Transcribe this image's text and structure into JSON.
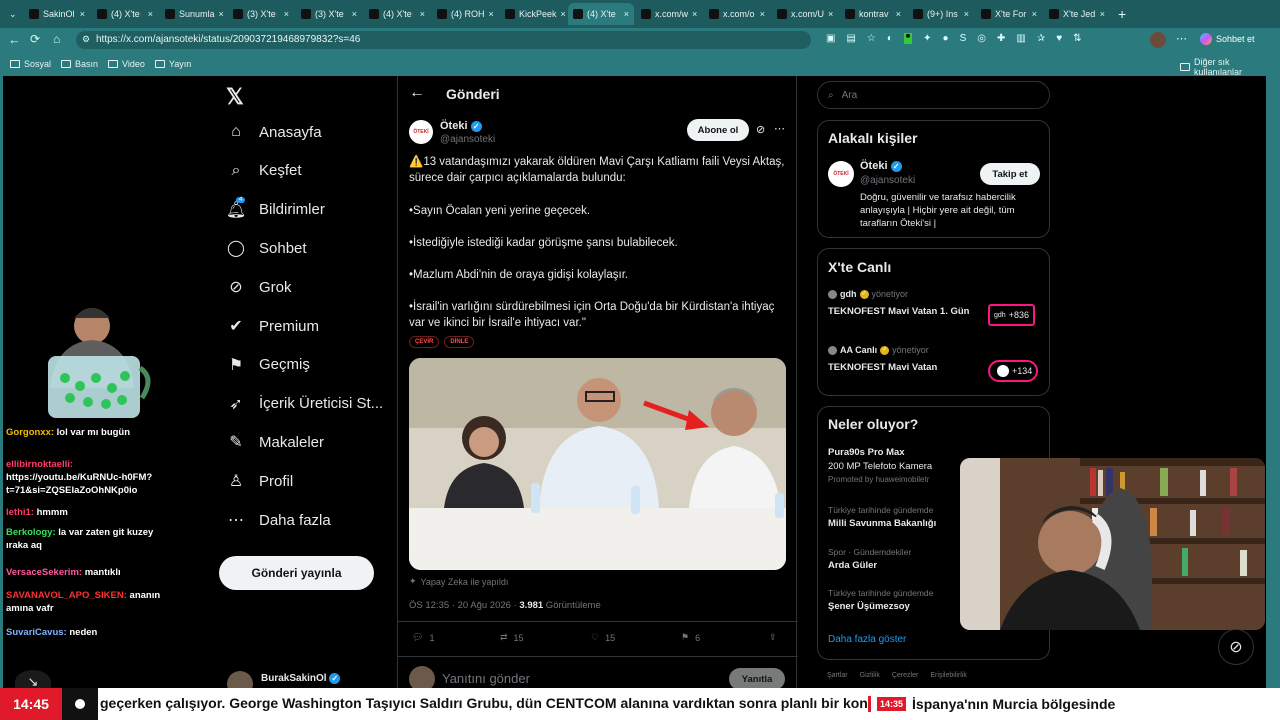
{
  "browser": {
    "tabs": [
      {
        "label": "SakinOl",
        "active": false
      },
      {
        "label": "(4) X'te",
        "active": false
      },
      {
        "label": "Sunumla",
        "active": false
      },
      {
        "label": "(3) X'te",
        "active": false
      },
      {
        "label": "(3) X'te",
        "active": false
      },
      {
        "label": "(4) X'te",
        "active": false
      },
      {
        "label": "(4) ROH",
        "active": false
      },
      {
        "label": "KickPeek",
        "active": false
      },
      {
        "label": "(4) X'te",
        "active": true
      },
      {
        "label": "x.com/w",
        "active": false
      },
      {
        "label": "x.com/o",
        "active": false
      },
      {
        "label": "x.com/U",
        "active": false
      },
      {
        "label": "kontrav",
        "active": false
      },
      {
        "label": "(9+) Ins",
        "active": false
      },
      {
        "label": "X'te For",
        "active": false
      },
      {
        "label": "X'te Jed",
        "active": false
      }
    ],
    "url": "https://x.com/ajansoteki/status/209037219468979832?s=46",
    "profile_label": "Sohbet et",
    "bookmarks": [
      "Sosyal",
      "Basın",
      "Video",
      "Yayın"
    ],
    "other_bookmarks": "Diğer sık kullanılanlar"
  },
  "nav": {
    "items": [
      {
        "label": "Anasayfa",
        "icon": "home-icon"
      },
      {
        "label": "Keşfet",
        "icon": "search-icon"
      },
      {
        "label": "Bildirimler",
        "icon": "bell-icon",
        "badge": "4"
      },
      {
        "label": "Sohbet",
        "icon": "chat-icon"
      },
      {
        "label": "Grok",
        "icon": "grok-icon"
      },
      {
        "label": "Premium",
        "icon": "premium-icon"
      },
      {
        "label": "Geçmiş",
        "icon": "bookmark-icon"
      },
      {
        "label": "İçerik Üreticisi St...",
        "icon": "rocket-icon"
      },
      {
        "label": "Makaleler",
        "icon": "article-icon"
      },
      {
        "label": "Profil",
        "icon": "profile-icon"
      },
      {
        "label": "Daha fazla",
        "icon": "more-icon"
      }
    ],
    "post_button": "Gönderi yayınla",
    "account_name": "BurakSakinOl"
  },
  "post": {
    "header": "Gönderi",
    "author_name": "Öteki",
    "author_handle": "@ajansoteki",
    "follow_label": "Abone ol",
    "avatar_text": "ÖTEKİ",
    "lines": [
      "⚠️13 vatandaşımızı yakarak öldüren Mavi Çarşı Katliamı faili Veysi Aktaş, sürece dair çarpıcı açıklamalarda bulundu:",
      "•Sayın Öcalan yeni yerine geçecek.",
      "•İstediğiyle istediği kadar görüşme şansı bulabilecek.",
      "•Mazlum Abdi'nin de oraya gidişi kolaylaşır.",
      "•İsrail'in varlığını sürdürebilmesi için Orta Doğu'da bir Kürdistan'a ihtiyaç var ve ikinci bir İsrail'e ihtiyacı var.\""
    ],
    "tags": [
      "ÇEVİR",
      "DİNLE"
    ],
    "ai_note": "Yapay Zeka ile yapıldı",
    "time": "ÖS 12:35 · 20 Ağu 2026 · ",
    "views": "3.981",
    "views_label": " Görüntüleme",
    "replies": "1",
    "reposts": "15",
    "likes": "15",
    "bookmarks": "6",
    "reply_placeholder": "Yanıtını gönder",
    "reply_button": "Yanıtla"
  },
  "sidebar": {
    "search_placeholder": "Ara",
    "related_title": "Alakalı kişiler",
    "related": {
      "name": "Öteki",
      "handle": "@ajansoteki",
      "follow_label": "Takip et",
      "bio": "Doğru, güvenilir ve tarafsız habercilik anlayışıyla | Hiçbir yere ait değil, tüm tarafların Öteki'si |"
    },
    "live_title": "X'te Canlı",
    "live": [
      {
        "host": "gdh",
        "role": "yönetiyor",
        "title": "TEKNOFEST Mavi Vatan 1. Gün",
        "count": "+836",
        "badge": "gdh"
      },
      {
        "host": "AA Canlı",
        "role": "yönetiyor",
        "title": "TEKNOFEST Mavi Vatan",
        "count": "+134",
        "badge": ""
      }
    ],
    "trends_title": "Neler oluyor?",
    "trends": [
      {
        "context": "",
        "name": "Pura90s Pro Max",
        "sub": "200 MP Telefoto Kamera",
        "promo": "Promoted by huaweimobiletr"
      },
      {
        "context": "Türkiye tarihinde gündemde",
        "name": "Milli Savunma Bakanlığı",
        "sub": "",
        "promo": ""
      },
      {
        "context": "Spor · Gündemdekiler",
        "name": "Arda Güler",
        "sub": "",
        "promo": ""
      },
      {
        "context": "Türkiye tarihinde gündemde",
        "name": "Şener Üşümezsoy",
        "sub": "",
        "promo": ""
      }
    ],
    "show_more": "Daha fazla göster",
    "footer": [
      "Şartlar",
      "Gizlilik",
      "Çerezler",
      "Erişilebilirlik"
    ]
  },
  "chat": [
    {
      "user": "Gorgonxx:",
      "color": "#f0c000",
      "text": " lol var mı bugün"
    },
    {
      "user": "ellibirnoktaelli:",
      "color": "#ff3b6b",
      "text": " https://youtu.be/KuRNUc-h0FM?t=71&si=ZQSEIaZoOhNKp0io"
    },
    {
      "user": "lethi1:",
      "color": "#ff3b6b",
      "text": " hmmm"
    },
    {
      "user": "Berkology:",
      "color": "#36e25c",
      "text": " la var zaten git kuzey ıraka aq"
    },
    {
      "user": "VersaceSekerim:",
      "color": "#ff5aa0",
      "text": " mantıklı"
    },
    {
      "user": "SAVANAVOL_APO_SIKEN:",
      "color": "#ff3030",
      "text": " ananın amına vafr"
    },
    {
      "user": "SuvariCavus:",
      "color": "#7fb2ff",
      "text": " neden"
    }
  ],
  "ticker": {
    "clock": "14:45",
    "text": "geçerken çalışıyor. George Washington Taşıyıcı Saldırı Grubu, dün CENTCOM alanına vardıktan sonra planlı bir kon",
    "time2": "14:35",
    "text2": "İspanya'nın Murcia bölgesinde"
  },
  "colors": {
    "accent": "#1d9bf0",
    "chrome": "#2b7a7d",
    "ticker_red": "#e01a2b"
  }
}
